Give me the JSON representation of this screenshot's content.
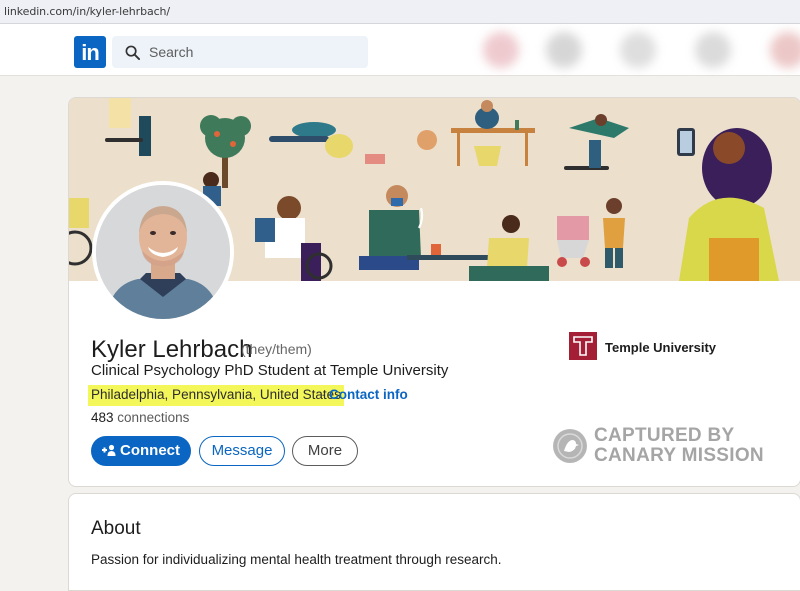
{
  "browser": {
    "url": "linkedin.com/in/kyler-lehrbach/"
  },
  "navbar": {
    "logo_text": "in",
    "search": {
      "placeholder": "Search",
      "icon": "search-icon"
    }
  },
  "profile": {
    "name": "Kyler Lehrbach",
    "pronouns": "(they/them)",
    "headline": "Clinical Psychology PhD Student at Temple University",
    "location": "Philadelphia, Pennsylvania, United States",
    "separator": "·",
    "contact_info": "Contact info",
    "connections_count": "483",
    "connections_label": "connections",
    "buttons": {
      "connect": "Connect",
      "message": "Message",
      "more": "More"
    },
    "education": {
      "name": "Temple University",
      "logo_letter": "T"
    }
  },
  "watermark": {
    "line1": "CAPTURED BY",
    "line2": "CANARY MISSION"
  },
  "about": {
    "title": "About",
    "text": "Passion for individualizing mental health treatment through research."
  },
  "colors": {
    "brand": "#0a66c2",
    "highlight": "#f4f75a",
    "temple": "#a41e35",
    "page_bg": "#f4f2ee"
  }
}
